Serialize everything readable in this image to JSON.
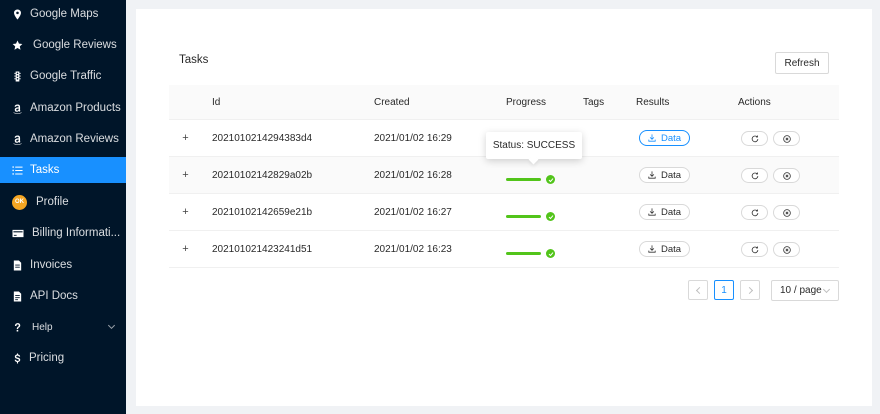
{
  "sidebar": {
    "items": [
      {
        "label": "Google Maps",
        "icon": "map-pin-icon"
      },
      {
        "label": "Google Reviews",
        "icon": "star-icon"
      },
      {
        "label": "Google Traffic",
        "icon": "traffic-light-icon"
      },
      {
        "label": "Amazon Products",
        "icon": "amazon-icon"
      },
      {
        "label": "Amazon Reviews",
        "icon": "amazon-icon"
      },
      {
        "label": "Tasks",
        "icon": "list-icon",
        "active": true
      },
      {
        "label": "Profile",
        "icon": "avatar",
        "avatar_text": "OK"
      },
      {
        "label": "Billing Informati...",
        "icon": "credit-card-icon"
      },
      {
        "label": "Invoices",
        "icon": "file-icon"
      },
      {
        "label": "API Docs",
        "icon": "file-text-icon"
      },
      {
        "label": "Help",
        "icon": "question-icon"
      },
      {
        "label": "Pricing",
        "icon": "dollar-icon"
      }
    ]
  },
  "main": {
    "title": "Tasks",
    "refresh_label": "Refresh",
    "columns": [
      "Id",
      "Created",
      "Progress",
      "Tags",
      "Results",
      "Actions"
    ],
    "expand_symbol": "+",
    "data_button_label": "Data",
    "rows": [
      {
        "id": "20210102142943​83d4",
        "created": "2021/01/02 16:29",
        "status": "SUCCESS"
      },
      {
        "id": "20210102142829a02b",
        "created": "2021/01/02 16:28",
        "status": "SUCCESS"
      },
      {
        "id": "20210102142659e21b",
        "created": "2021/01/02 16:27",
        "status": "SUCCESS"
      },
      {
        "id": "20210102142324​1d51",
        "created": "2021/01/02 16:23",
        "status": "SUCCESS"
      }
    ],
    "tooltip": "Status: SUCCESS",
    "pagination": {
      "current_page": "1",
      "page_size": "10 / page"
    }
  },
  "colors": {
    "sidebar_bg": "#001529",
    "accent": "#1890ff",
    "success": "#52c41a"
  }
}
